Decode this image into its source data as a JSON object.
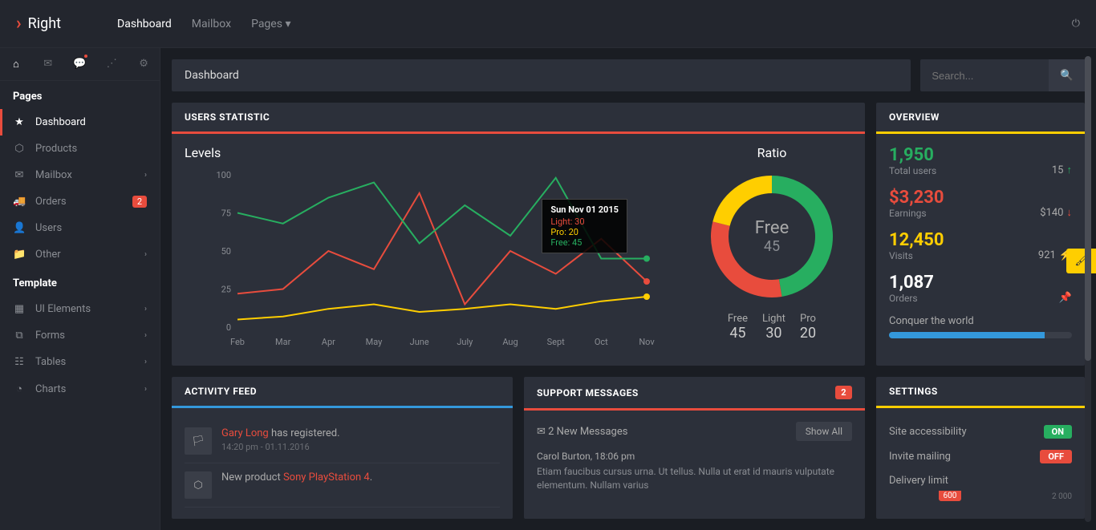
{
  "brand": "Right",
  "topnav": {
    "dashboard": "Dashboard",
    "mailbox": "Mailbox",
    "pages": "Pages"
  },
  "search": {
    "placeholder": "Search..."
  },
  "sidebar": {
    "section_pages": "Pages",
    "section_template": "Template",
    "items": {
      "dashboard": "Dashboard",
      "products": "Products",
      "mailbox": "Mailbox",
      "orders": "Orders",
      "orders_badge": "2",
      "users": "Users",
      "other": "Other",
      "ui": "UI Elements",
      "forms": "Forms",
      "tables": "Tables",
      "charts": "Charts"
    }
  },
  "page_title": "Dashboard",
  "stats": {
    "header": "USERS STATISTIC",
    "levels_title": "Levels",
    "ratio_title": "Ratio",
    "tooltip": {
      "title": "Sun Nov 01 2015",
      "light": "Light: 30",
      "pro": "Pro: 20",
      "free": "Free: 45"
    },
    "ratio_center_label": "Free",
    "ratio_center_value": "45",
    "legend": {
      "free": {
        "label": "Free",
        "value": "45"
      },
      "light": {
        "label": "Light",
        "value": "30"
      },
      "pro": {
        "label": "Pro",
        "value": "20"
      }
    }
  },
  "overview": {
    "header": "OVERVIEW",
    "users": {
      "value": "1,950",
      "label": "Total users",
      "right": "15"
    },
    "earnings": {
      "value": "$3,230",
      "label": "Earnings",
      "right": "$140"
    },
    "visits": {
      "value": "12,450",
      "label": "Visits",
      "right": "921"
    },
    "orders": {
      "value": "1,087",
      "label": "Orders"
    },
    "progress_label": "Conquer the world"
  },
  "activity": {
    "header": "ACTIVITY FEED",
    "items": [
      {
        "user": "Gary Long",
        "text": " has registered.",
        "meta": "14:20 pm - 01.11.2016"
      },
      {
        "prefix": "New product ",
        "product": "Sony PlayStation 4",
        "suffix": "."
      }
    ]
  },
  "support": {
    "header": "SUPPORT MESSAGES",
    "badge": "2",
    "msg_count": "2 New Messages",
    "show_all": "Show All",
    "from": "Carol Burton, 18:06 pm",
    "body": "Etiam faucibus cursus urna. Ut tellus. Nulla ut erat id mauris vulputate elementum. Nullam varius"
  },
  "settings": {
    "header": "SETTINGS",
    "rows": {
      "accessibility": {
        "label": "Site accessibility",
        "value": "ON"
      },
      "mailing": {
        "label": "Invite mailing",
        "value": "OFF"
      },
      "delivery": {
        "label": "Delivery limit",
        "current": "600",
        "max": "2 000"
      }
    }
  },
  "chart_data": {
    "type": "line",
    "title": "Levels",
    "ylim": [
      0,
      100
    ],
    "categories": [
      "Feb",
      "Mar",
      "Apr",
      "May",
      "June",
      "July",
      "Aug",
      "Sept",
      "Oct",
      "Nov"
    ],
    "series": [
      {
        "name": "Light",
        "color": "#e84c3d",
        "values": [
          22,
          25,
          50,
          38,
          88,
          15,
          50,
          35,
          58,
          30
        ]
      },
      {
        "name": "Pro",
        "color": "#ffce00",
        "values": [
          5,
          7,
          12,
          15,
          10,
          12,
          15,
          12,
          17,
          20
        ]
      },
      {
        "name": "Free",
        "color": "#27ae60",
        "values": [
          75,
          68,
          85,
          95,
          55,
          80,
          60,
          98,
          45,
          45
        ]
      }
    ],
    "donut": {
      "type": "pie",
      "title": "Ratio",
      "series": [
        {
          "name": "Free",
          "value": 45,
          "color": "#27ae60"
        },
        {
          "name": "Light",
          "value": 30,
          "color": "#e84c3d"
        },
        {
          "name": "Pro",
          "value": 20,
          "color": "#ffce00"
        }
      ]
    }
  }
}
